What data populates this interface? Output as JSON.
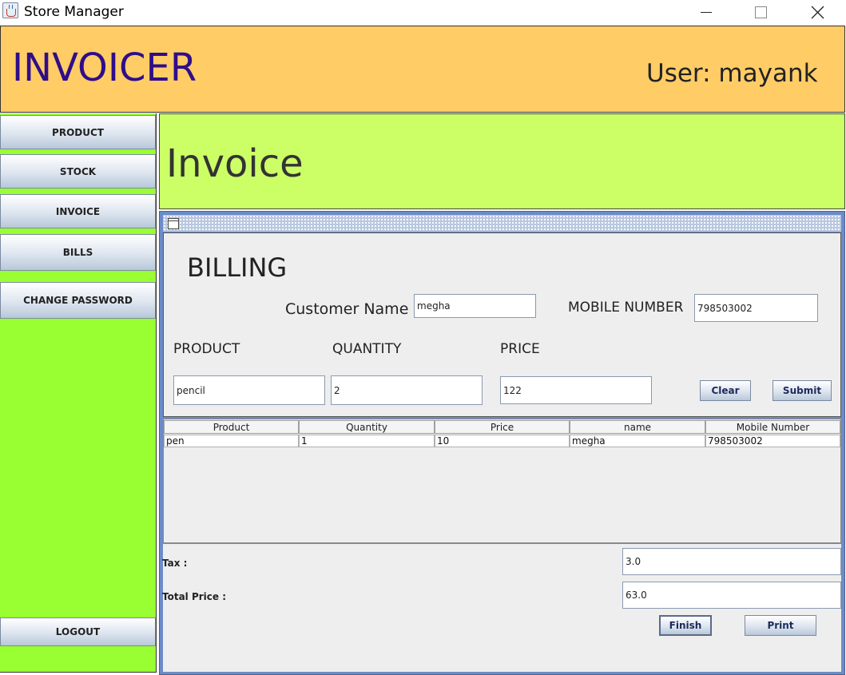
{
  "window": {
    "title": "Store Manager"
  },
  "header": {
    "app_name": "INVOICER",
    "user_label": "User: mayank"
  },
  "sidebar": {
    "items": [
      {
        "label": "PRODUCT"
      },
      {
        "label": "STOCK"
      },
      {
        "label": "INVOICE"
      },
      {
        "label": "BILLS"
      },
      {
        "label": "CHANGE PASSWORD"
      }
    ],
    "logout_label": "LOGOUT"
  },
  "page": {
    "title": "Invoice"
  },
  "billing": {
    "heading": "BILLING",
    "customer_name_label": "Customer Name",
    "customer_name_value": "megha",
    "mobile_label": "MOBILE NUMBER",
    "mobile_value": "798503002",
    "product_label": "PRODUCT",
    "quantity_label": "QUANTITY",
    "price_label": "PRICE",
    "product_value": "pencil",
    "quantity_value": "2",
    "price_value": "122",
    "clear_label": "Clear",
    "submit_label": "Submit"
  },
  "table": {
    "columns": [
      "Product",
      "Quantity",
      "Price",
      "name",
      "Mobile Number"
    ],
    "rows": [
      [
        "pen",
        "1",
        "10",
        "megha",
        "798503002"
      ]
    ]
  },
  "totals": {
    "tax_label": "Tax :",
    "tax_value": "3.0",
    "total_label": "Total Price :",
    "total_value": "63.0",
    "finish_label": "Finish",
    "print_label": "Print"
  },
  "colors": {
    "header_bg": "#ffcc66",
    "sidebar_bg": "#99ff33",
    "title_panel_bg": "#ccff66",
    "app_name_color": "#2f0d8a"
  }
}
